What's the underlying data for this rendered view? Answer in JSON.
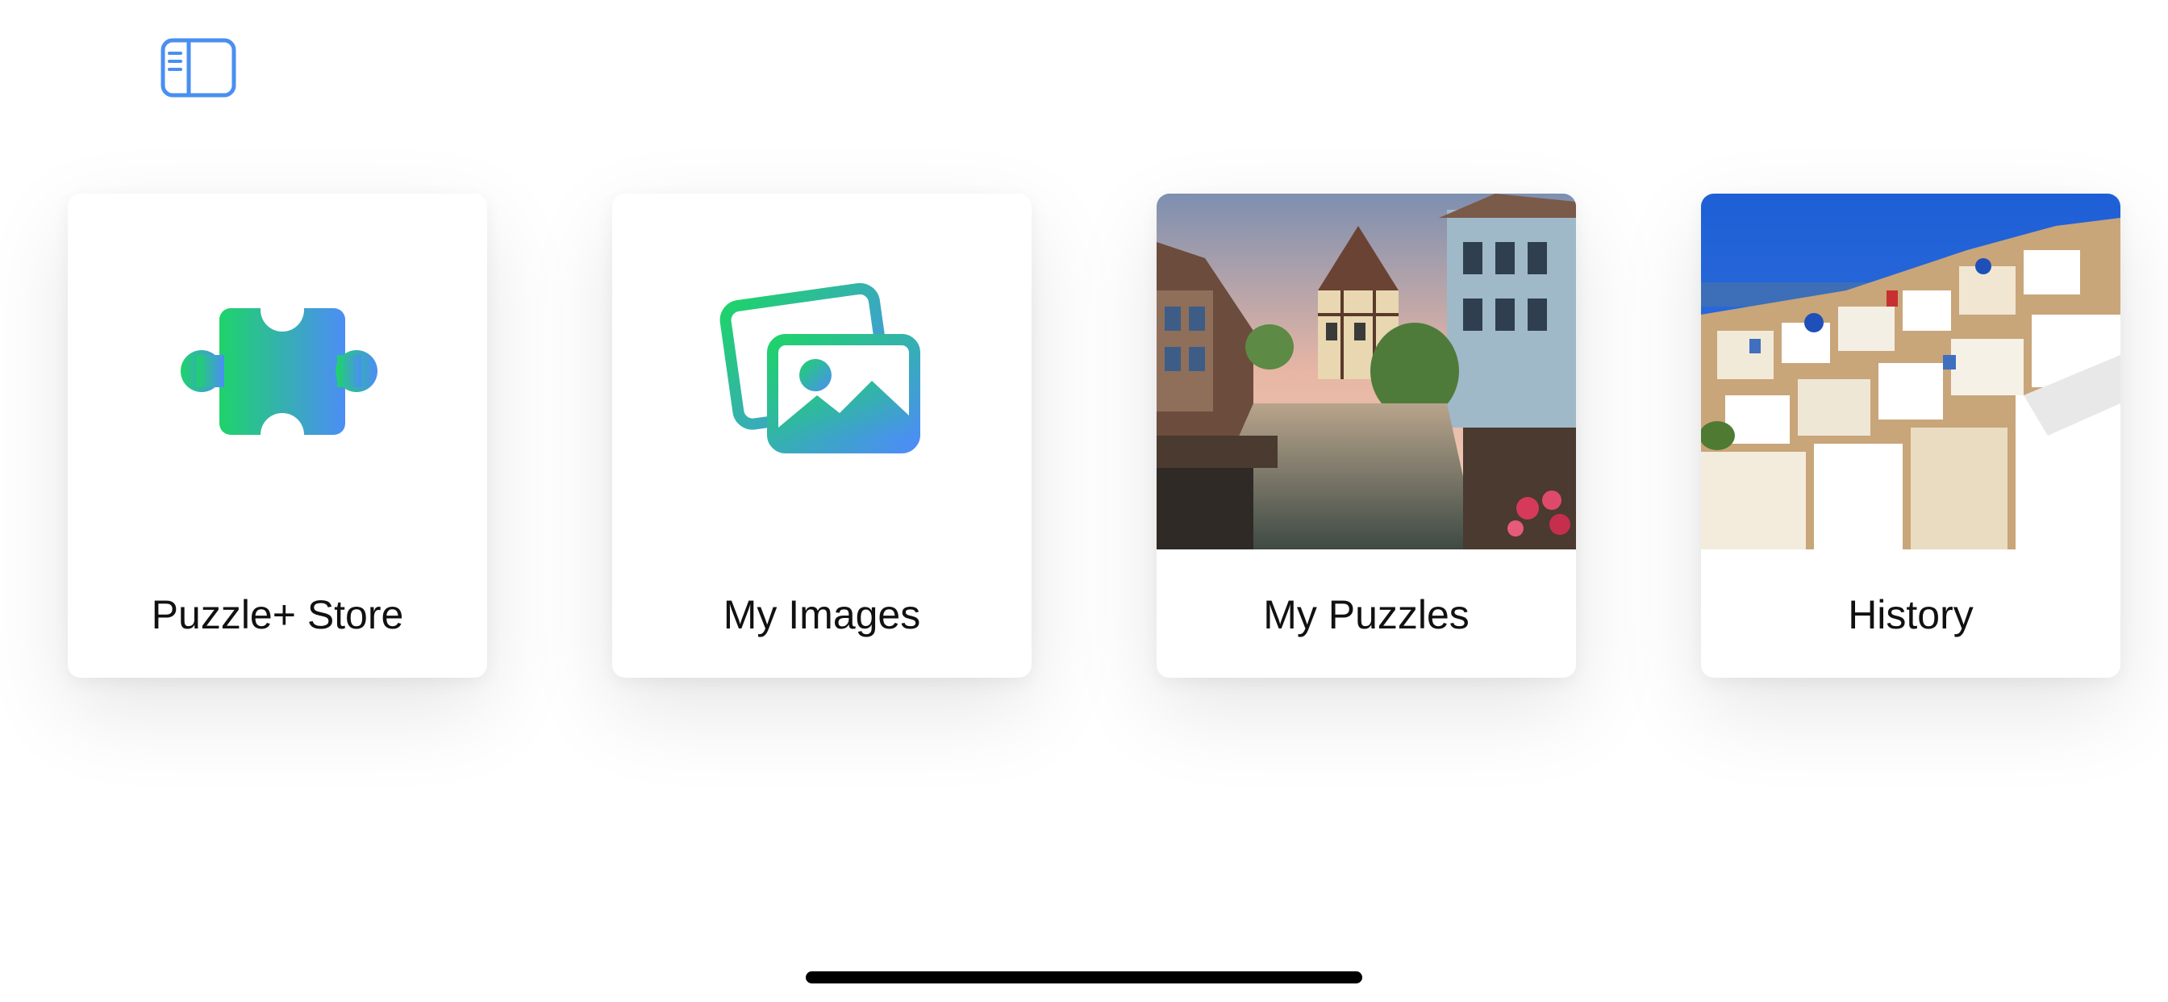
{
  "toolbar": {
    "sidebar_toggle_icon": "sidebar-left-icon",
    "accent_color": "#4A8FF0"
  },
  "cards": [
    {
      "label": "Puzzle+ Store",
      "icon": "puzzle-piece-icon"
    },
    {
      "label": "My Images",
      "icon": "photo-stack-icon"
    },
    {
      "label": "My Puzzles",
      "image": "canal-village-thumbnail"
    },
    {
      "label": "History",
      "image": "santorini-thumbnail"
    }
  ],
  "gradient": {
    "start": "#1ED36A",
    "end": "#4C8DF6"
  }
}
